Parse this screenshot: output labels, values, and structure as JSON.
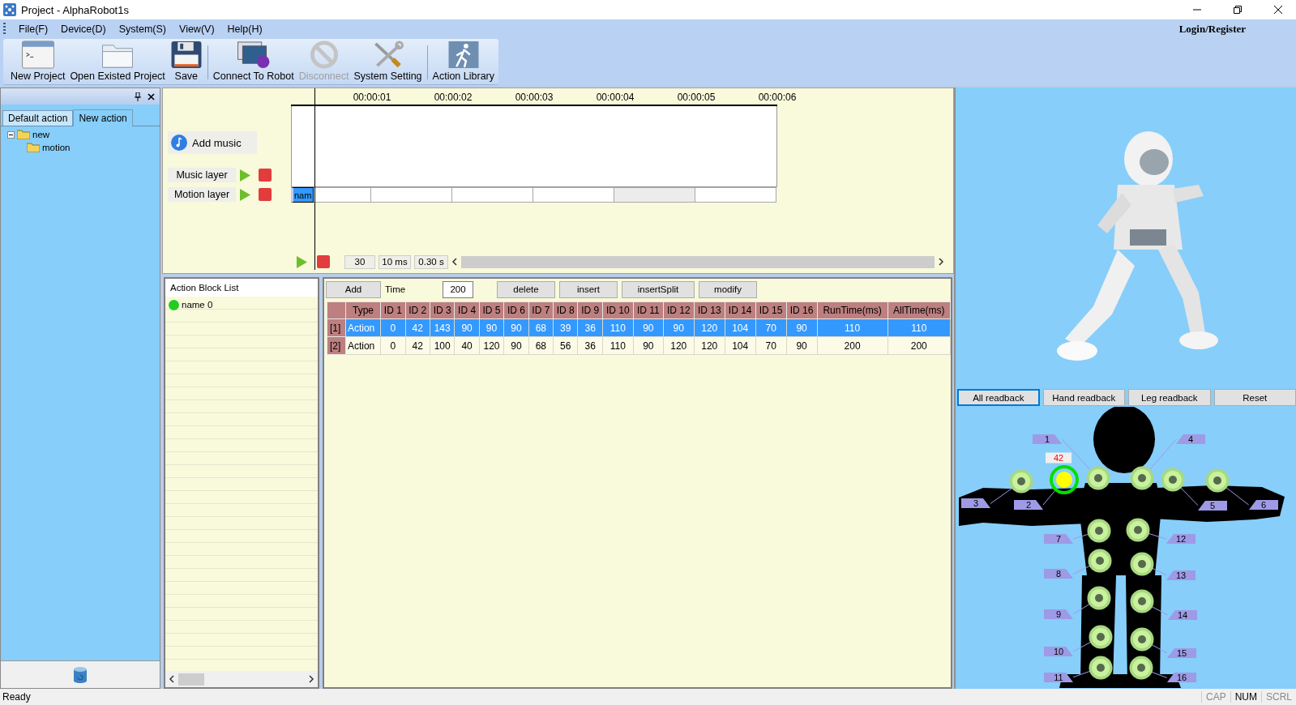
{
  "window": {
    "title": "Project - AlphaRobot1s"
  },
  "menu": [
    "File(F)",
    "Device(D)",
    "System(S)",
    "View(V)",
    "Help(H)"
  ],
  "login": "Login/Register",
  "toolbar": [
    [
      {
        "label": "New Project",
        "kind": "new",
        "disabled": false
      },
      {
        "label": "Open Existed Project",
        "kind": "open",
        "disabled": false
      },
      {
        "label": "Save",
        "kind": "save",
        "disabled": false
      }
    ],
    [
      {
        "label": "Connect To Robot",
        "kind": "connect",
        "disabled": false
      },
      {
        "label": "Disconnect",
        "kind": "disconnect",
        "disabled": true
      },
      {
        "label": "System Setting",
        "kind": "settings",
        "disabled": false
      }
    ],
    [
      {
        "label": "Action Library",
        "kind": "library",
        "disabled": false
      }
    ]
  ],
  "left_panel": {
    "tabs": [
      {
        "label": "Default action",
        "selected": false
      },
      {
        "label": "New action",
        "selected": true
      }
    ],
    "tree": [
      {
        "label": "new",
        "expanded": true,
        "children": [
          {
            "label": "motion"
          }
        ]
      }
    ]
  },
  "timeline": {
    "add_music": "Add music",
    "layers": [
      "Music layer",
      "Motion layer"
    ],
    "ruler": [
      "00:00:01",
      "00:00:02",
      "00:00:03",
      "00:00:04",
      "00:00:05",
      "00:00:06"
    ],
    "motion_block": "nam",
    "frames": "30",
    "interval": "10 ms",
    "duration": "0.30 s"
  },
  "action_blocks": {
    "title": "Action Block List",
    "items": [
      {
        "label": "name 0",
        "color": "#22cc22"
      }
    ]
  },
  "action_toolbar": {
    "add": "Add",
    "time_label": "Time",
    "time_value": "200",
    "buttons": [
      "delete",
      "insert",
      "insertSplit",
      "modify"
    ]
  },
  "table": {
    "columns": [
      "Type",
      "ID 1",
      "ID 2",
      "ID 3",
      "ID 4",
      "ID 5",
      "ID 6",
      "ID 7",
      "ID 8",
      "ID 9",
      "ID 10",
      "ID 11",
      "ID 12",
      "ID 13",
      "ID 14",
      "ID 15",
      "ID 16",
      "RunTime(ms)",
      "AllTime(ms)"
    ],
    "rows": [
      {
        "index": "[1]",
        "selected": true,
        "cells": [
          "Action",
          "0",
          "42",
          "143",
          "90",
          "90",
          "90",
          "68",
          "39",
          "36",
          "110",
          "90",
          "90",
          "120",
          "104",
          "70",
          "90",
          "110",
          "110"
        ]
      },
      {
        "index": "[2]",
        "selected": false,
        "cells": [
          "Action",
          "0",
          "42",
          "100",
          "40",
          "120",
          "90",
          "68",
          "56",
          "36",
          "110",
          "90",
          "120",
          "120",
          "104",
          "70",
          "90",
          "200",
          "200"
        ]
      }
    ]
  },
  "readback": [
    {
      "label": "All readback",
      "selected": true
    },
    {
      "label": "Hand readback",
      "selected": false
    },
    {
      "label": "Leg readback",
      "selected": false
    },
    {
      "label": "Reset",
      "selected": false
    }
  ],
  "joints": [
    {
      "label": "1",
      "selected": false
    },
    {
      "label": "4",
      "selected": false
    },
    {
      "label": "3",
      "selected": false
    },
    {
      "label": "2",
      "selected": true,
      "reading": "42"
    },
    {
      "label": "5",
      "selected": false
    },
    {
      "label": "6",
      "selected": false
    },
    {
      "label": "7",
      "selected": false
    },
    {
      "label": "12",
      "selected": false
    },
    {
      "label": "8",
      "selected": false
    },
    {
      "label": "13",
      "selected": false
    },
    {
      "label": "9",
      "selected": false
    },
    {
      "label": "14",
      "selected": false
    },
    {
      "label": "10",
      "selected": false
    },
    {
      "label": "15",
      "selected": false
    },
    {
      "label": "11",
      "selected": false
    },
    {
      "label": "16",
      "selected": false
    }
  ],
  "status_bar": {
    "text": "Ready",
    "indicators": [
      {
        "label": "CAP",
        "on": false
      },
      {
        "label": "NUM",
        "on": true
      },
      {
        "label": "SCRL",
        "on": false
      }
    ]
  }
}
